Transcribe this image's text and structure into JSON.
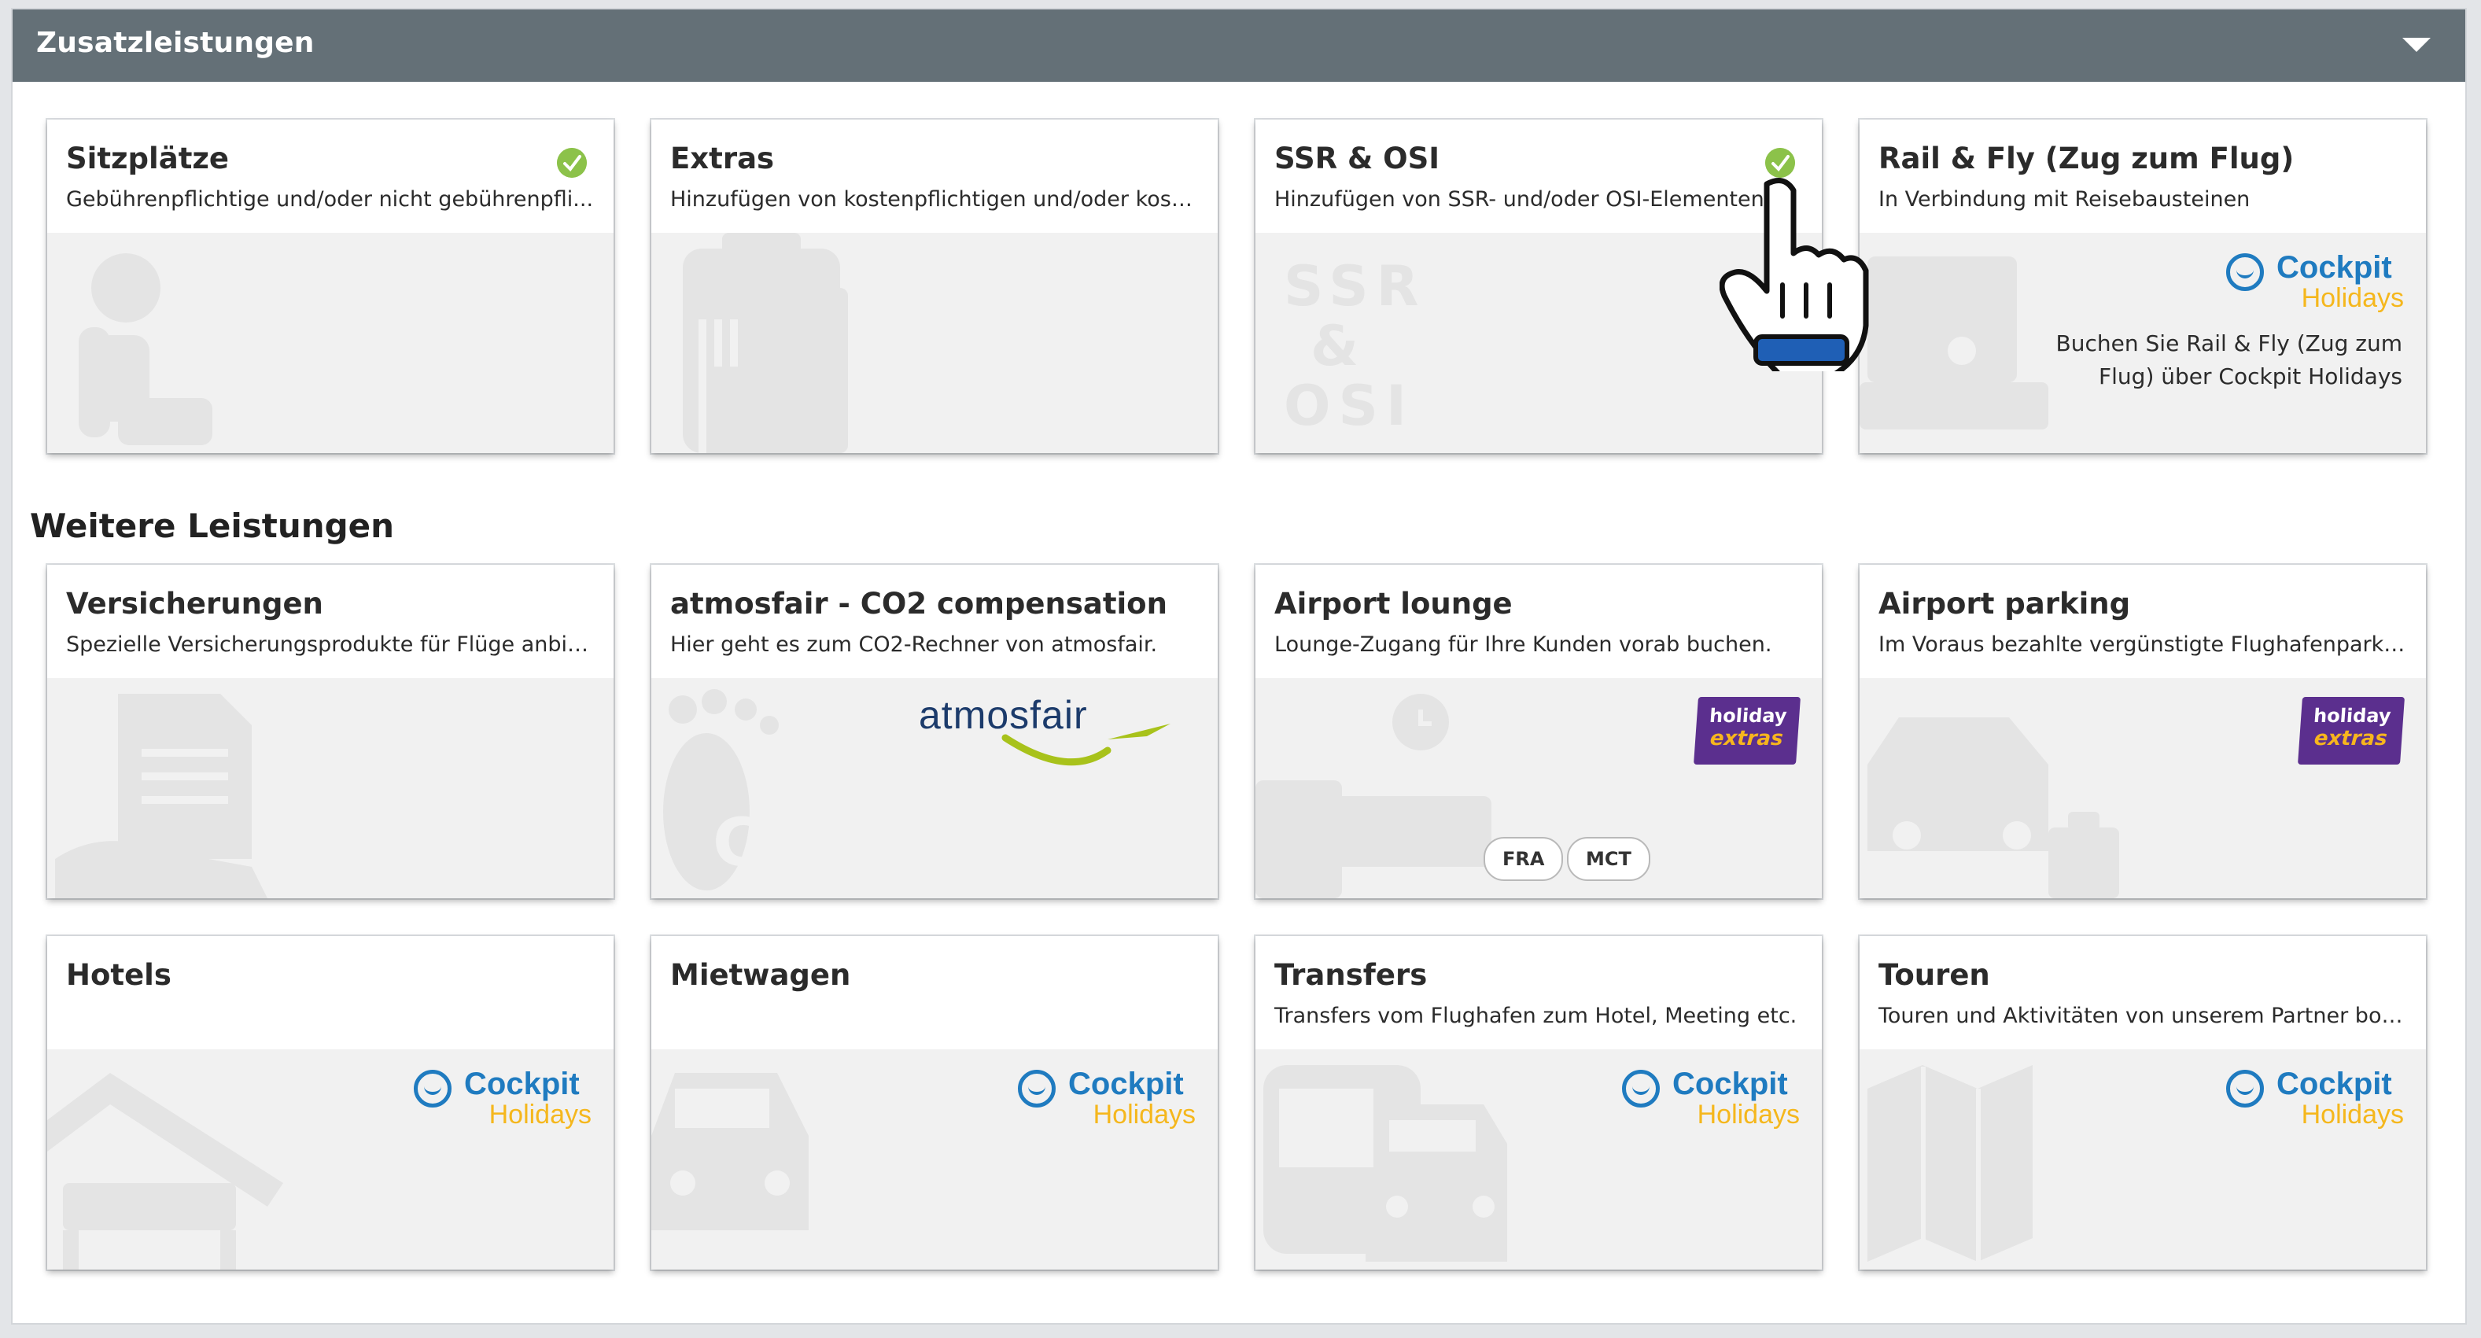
{
  "panel": {
    "title": "Zusatzleistungen"
  },
  "section2": {
    "title": "Weitere Leistungen"
  },
  "cards": {
    "sitzplaetze": {
      "title": "Sitzplätze",
      "desc": "Gebührenpflichtige und/oder nicht gebührenpfli..."
    },
    "extras": {
      "title": "Extras",
      "desc": "Hinzufügen von kostenpflichtigen und/oder kost..."
    },
    "ssr": {
      "title": "SSR & OSI",
      "desc": "Hinzufügen von SSR- und/oder OSI-Elementen",
      "watermark": [
        "SSR",
        "&",
        "OSI"
      ]
    },
    "rail": {
      "title": "Rail & Fly (Zug zum Flug)",
      "desc": "In Verbindung mit Reisebausteinen",
      "body_line1": "Buchen Sie Rail & Fly (Zug zum",
      "body_line2": "Flug) über Cockpit Holidays"
    },
    "versicherungen": {
      "title": "Versicherungen",
      "desc": "Spezielle Versicherungsprodukte für Flüge anbiet..."
    },
    "atmosfair": {
      "title": "atmosfair - CO2 compensation",
      "desc": "Hier geht es zum CO2-Rechner von atmosfair.",
      "logo_text": "atmosfair",
      "watermark": "CO₂"
    },
    "lounge": {
      "title": "Airport lounge",
      "desc": "Lounge-Zugang für Ihre Kunden vorab buchen.",
      "chips": [
        "FRA",
        "MCT"
      ]
    },
    "parking": {
      "title": "Airport parking",
      "desc": "Im Voraus bezahlte vergünstigte Flughafenparkp..."
    },
    "hotels": {
      "title": "Hotels"
    },
    "mietwagen": {
      "title": "Mietwagen"
    },
    "transfers": {
      "title": "Transfers",
      "desc": "Transfers vom Flughafen zum Hotel, Meeting etc."
    },
    "touren": {
      "title": "Touren",
      "desc": "Touren und Aktivitäten von unserem Partner boo..."
    }
  },
  "logos": {
    "cockpit": {
      "line1": "Cockpit",
      "line2": "Holidays"
    },
    "holiday_extras": {
      "line1": "holiday",
      "line2": "extras"
    }
  },
  "colors": {
    "header": "#647077",
    "check": "#8cc24a",
    "cockpit_blue": "#1f7bc0",
    "cockpit_yellow": "#f5b71d",
    "hx_purple": "#5b2f8e",
    "atmos_green": "#a8c21b",
    "atmos_navy": "#1c3b6b"
  },
  "icons": {
    "collapse": "caret-down-icon",
    "selected": "check-icon",
    "cursor": "hand-pointer-icon"
  }
}
